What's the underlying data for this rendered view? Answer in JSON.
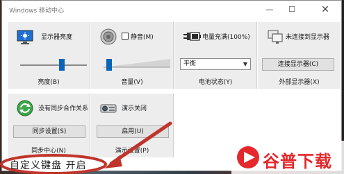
{
  "window": {
    "title": "Windows 移动中心",
    "minimize_glyph": "—",
    "maximize_glyph": "☐",
    "close_glyph": "✕"
  },
  "tiles": {
    "brightness": {
      "label": "显示器亮度",
      "footer": "亮度(B)",
      "level_percent": 62,
      "icon": "display-brightness-icon"
    },
    "volume": {
      "label": "静音(M)",
      "footer": "音量(V)",
      "muted": false,
      "level_percent": 8,
      "icon": "speaker-icon"
    },
    "battery": {
      "label": "电量充满(100%)",
      "footer": "电池状态(Y)",
      "plan": "平衡",
      "icon": "battery-plug-icon"
    },
    "external_display": {
      "label": "未连接到显示器",
      "footer": "外部显示器(X)",
      "button": "连接显示器(C)",
      "icon": "monitor-icon"
    },
    "sync": {
      "label": "没有同步合作关系",
      "footer": "同步中心(N)",
      "button": "同步设置(S)",
      "icon": "sync-center-icon"
    },
    "presentation": {
      "label": "演示关闭",
      "footer": "演示设置(P)",
      "button": "启用(U)",
      "icon": "projector-icon"
    }
  },
  "annotation": {
    "text": "自定义键盘   开启",
    "color": "#c0352b"
  },
  "watermark": {
    "text": "谷普下载",
    "color": "#e4282b"
  }
}
